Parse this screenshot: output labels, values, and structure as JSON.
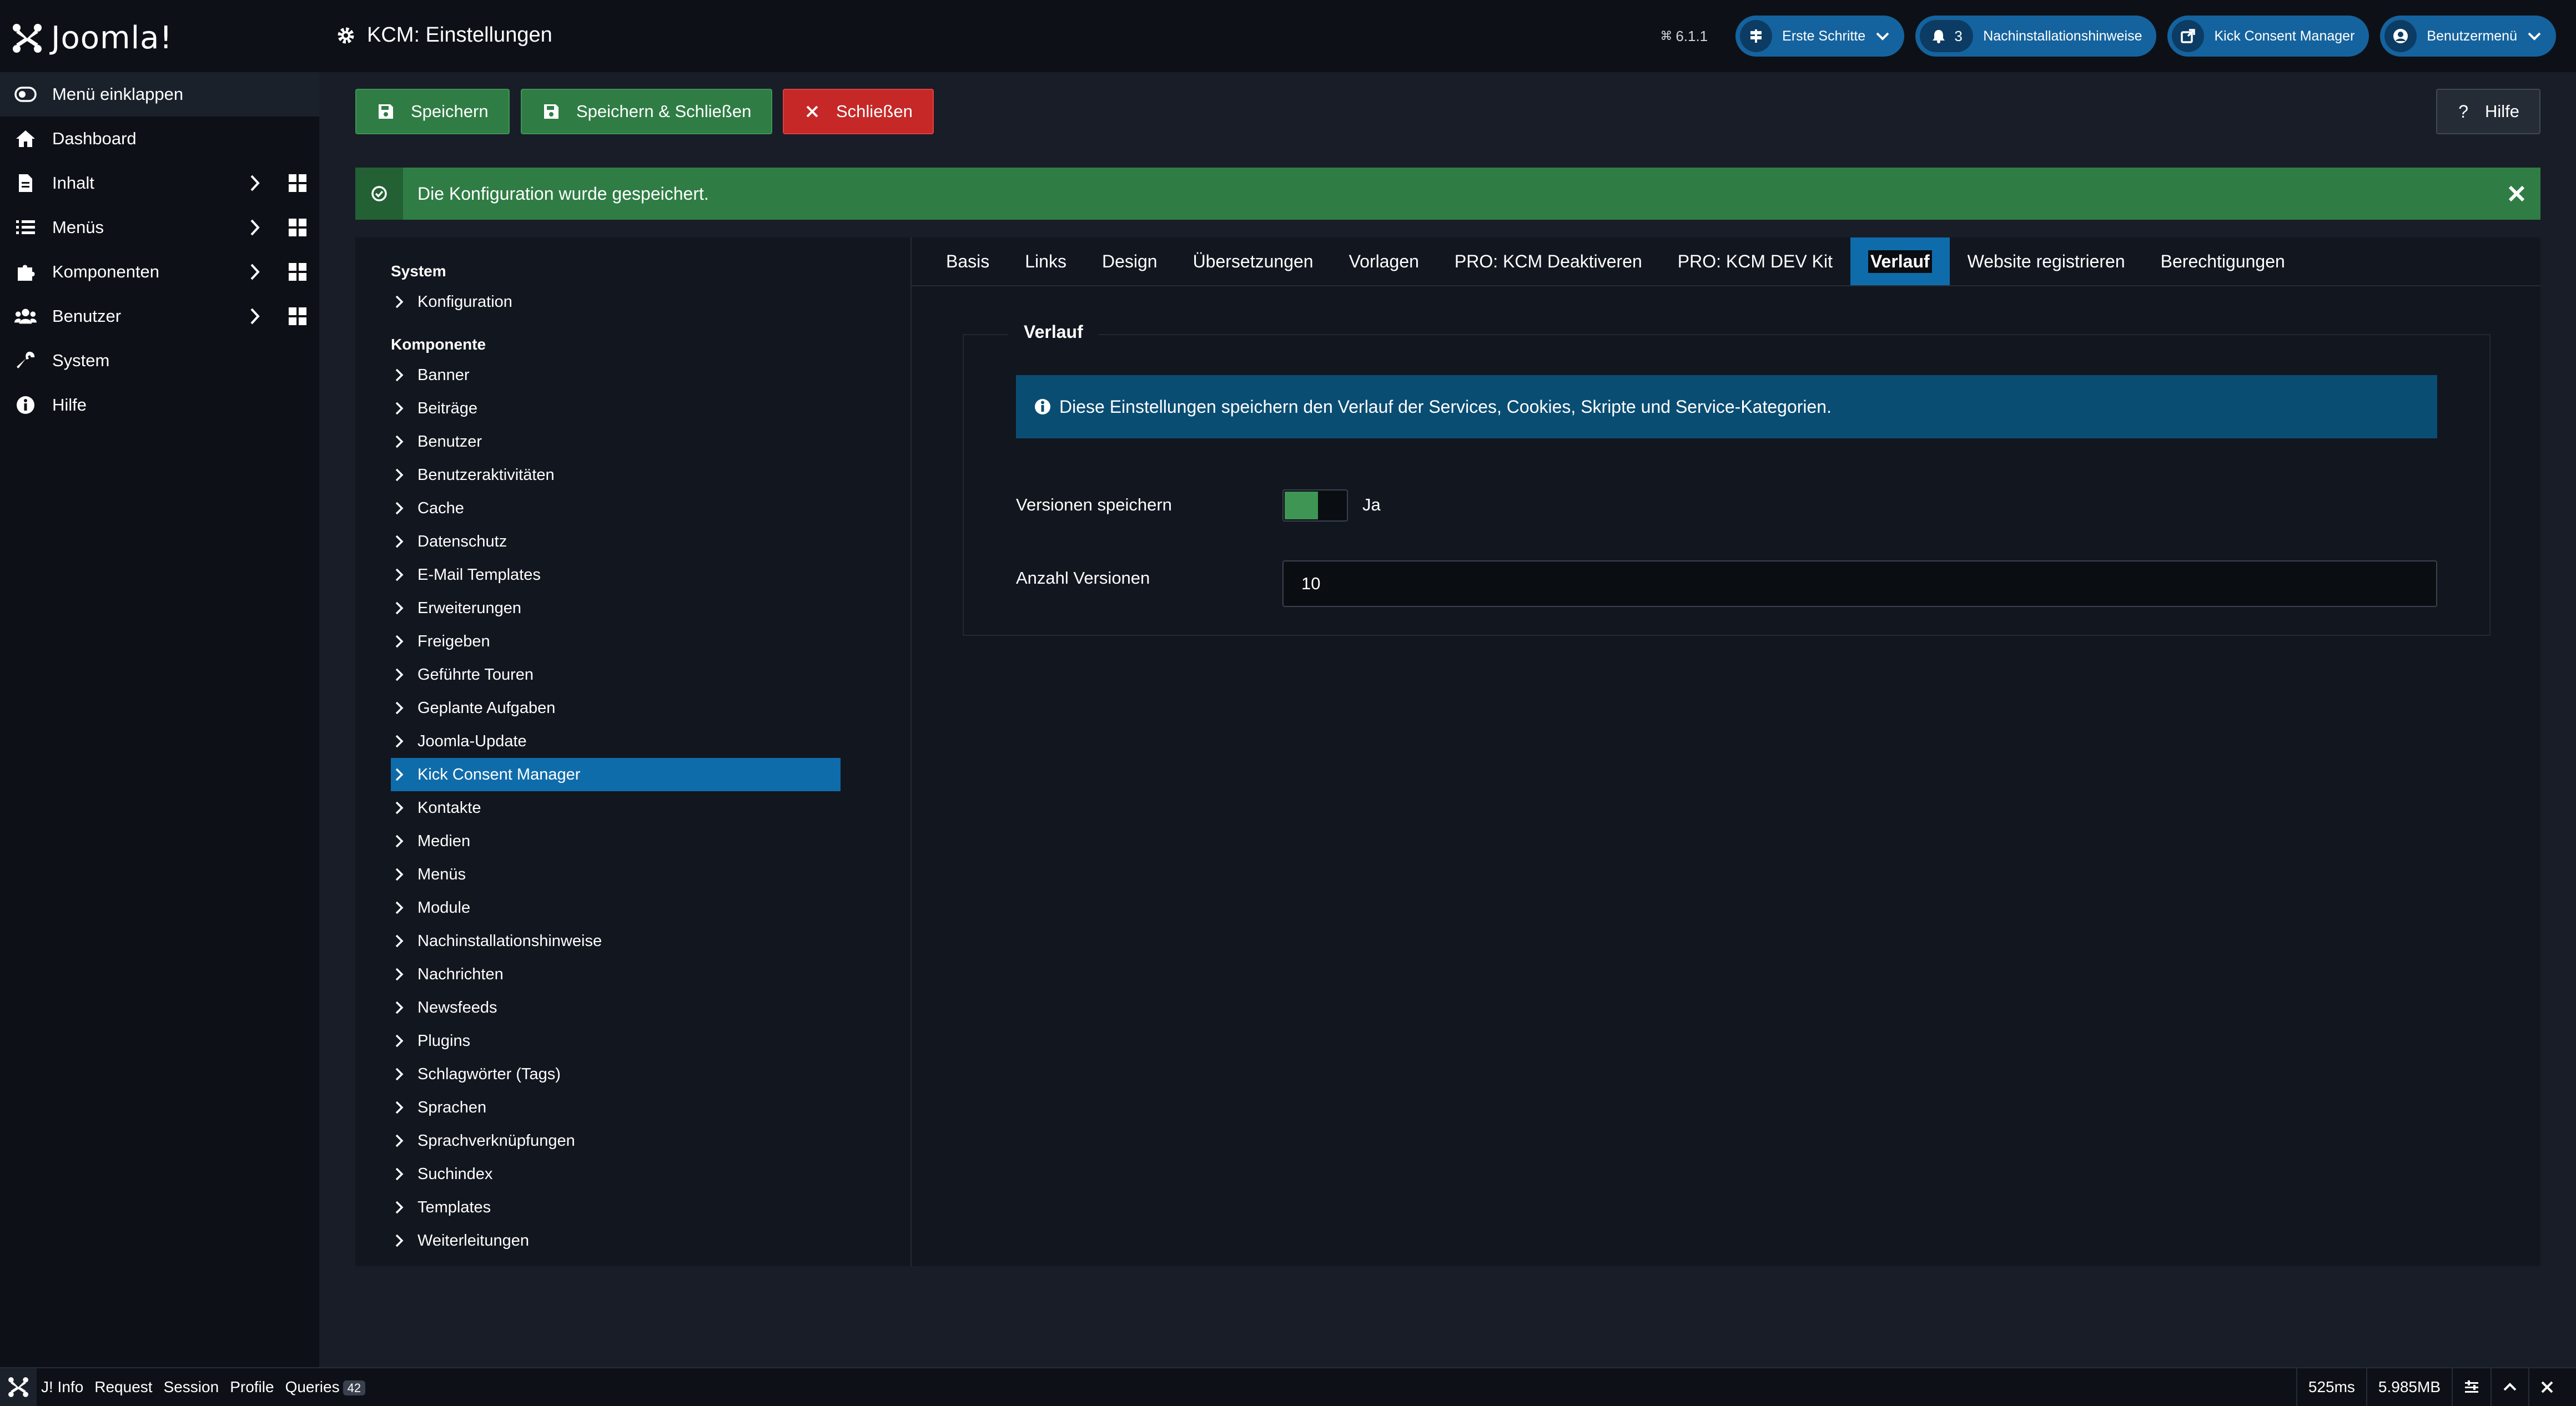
{
  "header": {
    "logo_text": "Joomla!",
    "page_title": "KCM: Einstellungen",
    "version": "6.1.1",
    "pills": {
      "getting_started": "Erste Schritte",
      "notifications_count": "3",
      "post_install": "Nachinstallationshinweise",
      "kcm": "Kick Consent Manager",
      "user_menu": "Benutzermenü"
    }
  },
  "sidebar": {
    "collapse": "Menü einklappen",
    "items": [
      {
        "label": "Dashboard",
        "icon": "home-icon"
      },
      {
        "label": "Inhalt",
        "icon": "file-icon"
      },
      {
        "label": "Menüs",
        "icon": "list-icon"
      },
      {
        "label": "Komponenten",
        "icon": "puzzle-icon"
      },
      {
        "label": "Benutzer",
        "icon": "users-icon"
      },
      {
        "label": "System",
        "icon": "wrench-icon"
      },
      {
        "label": "Hilfe",
        "icon": "info-icon"
      }
    ]
  },
  "toolbar": {
    "save": "Speichern",
    "save_close": "Speichern & Schließen",
    "close": "Schließen",
    "help": "Hilfe"
  },
  "alert": {
    "message": "Die Konfiguration wurde gespeichert."
  },
  "tree": {
    "group_system": "System",
    "system_items": [
      "Konfiguration"
    ],
    "group_component": "Komponente",
    "component_items": [
      "Banner",
      "Beiträge",
      "Benutzer",
      "Benutzeraktivitäten",
      "Cache",
      "Datenschutz",
      "E-Mail Templates",
      "Erweiterungen",
      "Freigeben",
      "Geführte Touren",
      "Geplante Aufgaben",
      "Joomla-Update",
      "Kick Consent Manager",
      "Kontakte",
      "Medien",
      "Menüs",
      "Module",
      "Nachinstallationshinweise",
      "Nachrichten",
      "Newsfeeds",
      "Plugins",
      "Schlagwörter (Tags)",
      "Sprachen",
      "Sprachverknüpfungen",
      "Suchindex",
      "Templates",
      "Weiterleitungen"
    ],
    "active": "Kick Consent Manager"
  },
  "tabs": [
    "Basis",
    "Links",
    "Design",
    "Übersetzungen",
    "Vorlagen",
    "PRO: KCM Deaktiveren",
    "PRO: KCM DEV Kit",
    "Verlauf",
    "Website registrieren",
    "Berechtigungen"
  ],
  "active_tab": "Verlauf",
  "form": {
    "legend": "Verlauf",
    "info": "Diese Einstellungen speichern den Verlauf der Services, Cookies, Skripte und Service-Kategorien.",
    "save_versions_label": "Versionen speichern",
    "save_versions_value": "Ja",
    "num_versions_label": "Anzahl Versionen",
    "num_versions_value": "10"
  },
  "debugbar": {
    "items": [
      "J! Info",
      "Request",
      "Session",
      "Profile",
      "Queries"
    ],
    "queries_count": "42",
    "time": "525ms",
    "memory": "5.985MB"
  },
  "colors": {
    "success": "#2f7d44",
    "danger": "#c52827",
    "primary": "#0f6cab",
    "header_bg": "#0d1117"
  }
}
